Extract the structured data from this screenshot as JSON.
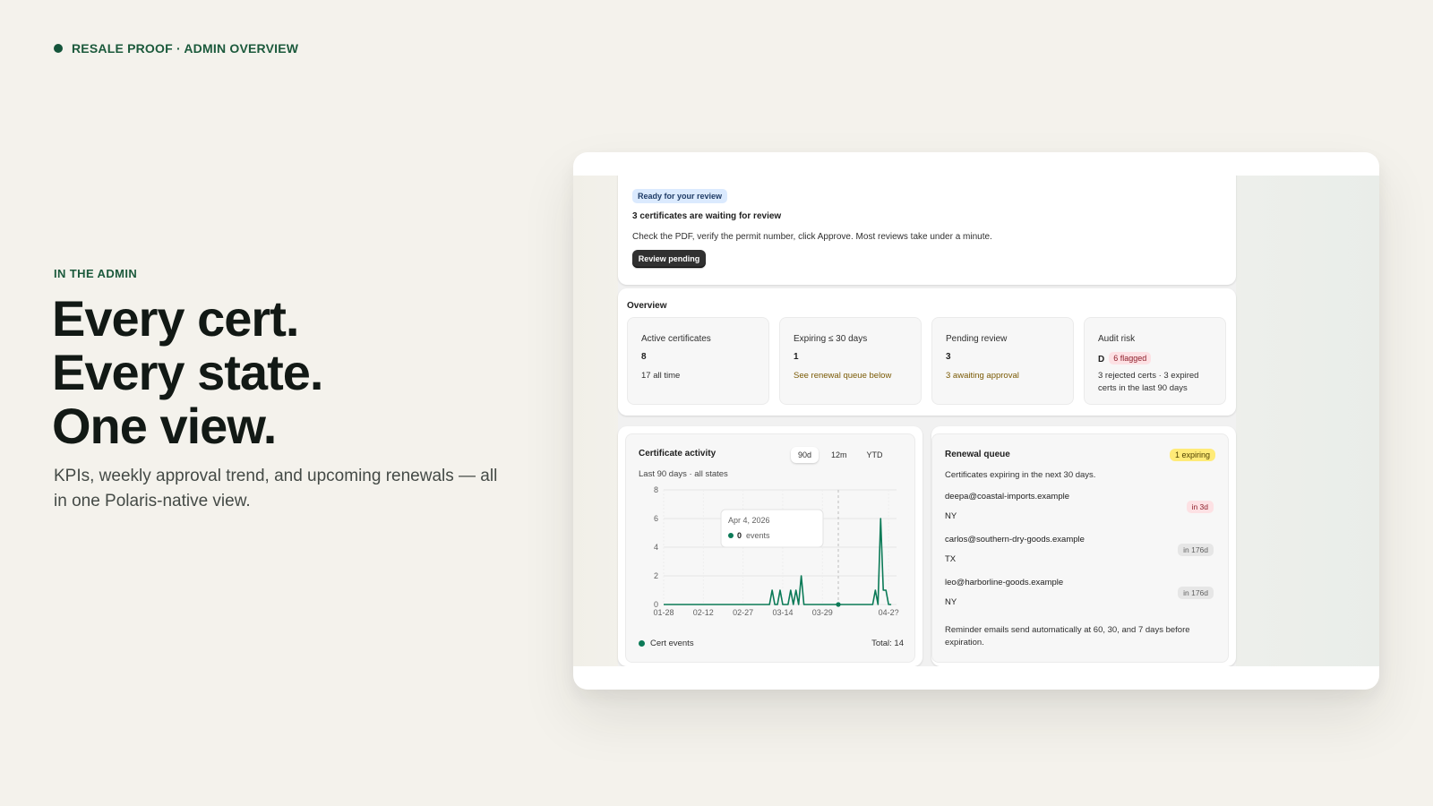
{
  "hero": {
    "eyebrow": "RESALE PROOF · ADMIN OVERVIEW",
    "section_label": "IN THE ADMIN",
    "headline": [
      "Every cert.",
      "Every state.",
      "One view."
    ],
    "subcopy": "KPIs, weekly approval trend, and upcoming renewals — all in one Polaris-native view."
  },
  "review": {
    "badge": "Ready for your review",
    "title": "3 certificates are waiting for review",
    "description": "Check the PDF, verify the permit number, click Approve. Most reviews take under a minute.",
    "button_label": "Review pending"
  },
  "overview": {
    "title": "Overview",
    "kpis": [
      {
        "label": "Active certificates",
        "value": "8",
        "sub": "17 all time",
        "tone": "neutral"
      },
      {
        "label": "Expiring ≤ 30 days",
        "value": "1",
        "sub": "See renewal queue below",
        "tone": "warn"
      },
      {
        "label": "Pending review",
        "value": "3",
        "sub": "3 awaiting approval",
        "tone": "warn"
      },
      {
        "label": "Audit risk",
        "value": "D",
        "badge": "6 flagged",
        "sub": "3 rejected certs · 3 expired certs in the last 90 days",
        "tone": "neutral"
      }
    ]
  },
  "activity": {
    "title": "Certificate activity",
    "subtitle": "Last 90 days · all states",
    "ranges": [
      "90d",
      "12m",
      "YTD"
    ],
    "active_range": "90d",
    "legend": "Cert events",
    "total": "Total: 14",
    "tooltip": {
      "date": "Apr 4, 2026",
      "value": "0",
      "unit": "events"
    }
  },
  "chart_data": {
    "type": "line",
    "title": "Certificate activity",
    "xlabel": "",
    "ylabel": "",
    "x_tick_labels": [
      "01-28",
      "02-12",
      "02-27",
      "03-14",
      "03-29",
      "04-2?"
    ],
    "y_ticks": [
      0,
      2,
      4,
      6,
      8
    ],
    "ylim": [
      0,
      8
    ],
    "grid": true,
    "series": [
      {
        "name": "Cert events",
        "color": "#0b7a57",
        "x": [
          "01-28",
          "02-04",
          "02-11",
          "02-18",
          "02-25",
          "03-04",
          "03-08",
          "03-09",
          "03-10",
          "03-11",
          "03-12",
          "03-13",
          "03-14",
          "03-15",
          "03-16",
          "03-17",
          "03-18",
          "03-19",
          "03-20",
          "03-21",
          "03-22",
          "03-23",
          "03-24",
          "03-25",
          "03-30",
          "04-04",
          "04-08",
          "04-17",
          "04-18",
          "04-19",
          "04-20",
          "04-21",
          "04-22",
          "04-23",
          "04-24"
        ],
        "values": [
          0,
          0,
          0,
          0,
          0,
          0,
          0,
          0,
          1,
          0,
          0,
          1,
          0,
          0,
          0,
          1,
          0,
          1,
          0,
          2,
          0,
          0,
          0,
          0,
          0,
          0,
          0,
          0,
          1,
          0,
          6,
          1,
          1,
          0,
          0
        ]
      }
    ],
    "total": 14
  },
  "renewal": {
    "title": "Renewal queue",
    "badge": "1 expiring",
    "subtitle": "Certificates expiring in the next 30 days.",
    "rows": [
      {
        "email": "deepa@coastal-imports.example",
        "state": "NY",
        "due": "in 3d",
        "tone": "critical"
      },
      {
        "email": "carlos@southern-dry-goods.example",
        "state": "TX",
        "due": "in 176d",
        "tone": "neutral"
      },
      {
        "email": "leo@harborline-goods.example",
        "state": "NY",
        "due": "in 176d",
        "tone": "neutral"
      }
    ],
    "footer": "Reminder emails send automatically at 60, 30, and 7 days before expiration."
  }
}
